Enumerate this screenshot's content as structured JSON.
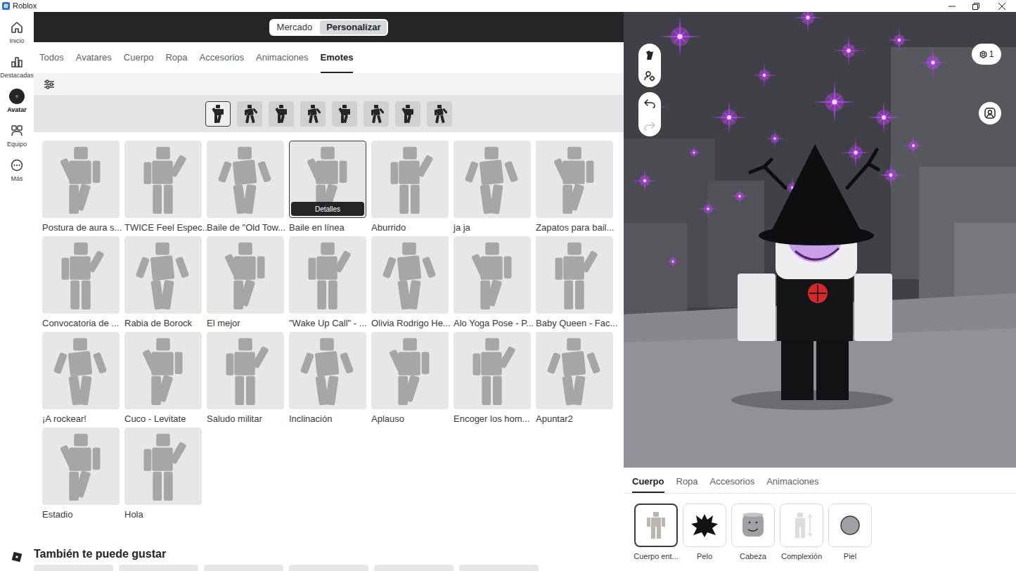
{
  "window": {
    "title": "Roblox"
  },
  "sidebar": {
    "items": [
      {
        "label": "Inicio",
        "selected": false
      },
      {
        "label": "Destacadas",
        "selected": false
      },
      {
        "label": "Avatar",
        "selected": true
      },
      {
        "label": "Equipo",
        "selected": false
      },
      {
        "label": "Más",
        "selected": false
      }
    ]
  },
  "mode_toggle": [
    {
      "label": "Mercado",
      "selected": false
    },
    {
      "label": "Personalizar",
      "selected": true
    }
  ],
  "category_tabs": [
    {
      "label": "Todos",
      "selected": false
    },
    {
      "label": "Avatares",
      "selected": false
    },
    {
      "label": "Cuerpo",
      "selected": false
    },
    {
      "label": "Ropa",
      "selected": false
    },
    {
      "label": "Accesorios",
      "selected": false
    },
    {
      "label": "Animaciones",
      "selected": false
    },
    {
      "label": "Emotes",
      "selected": true
    }
  ],
  "emote_slots": [
    {
      "selected": true
    },
    {
      "selected": false
    },
    {
      "selected": false
    },
    {
      "selected": false
    },
    {
      "selected": false
    },
    {
      "selected": false
    },
    {
      "selected": false
    },
    {
      "selected": false
    }
  ],
  "emotes": {
    "details_button": "Detalles",
    "items": [
      {
        "label": "Postura de aura s...",
        "hovered": false
      },
      {
        "label": "TWICE Feel Espec...",
        "hovered": false
      },
      {
        "label": "Baile de \"Old Tow...",
        "hovered": false
      },
      {
        "label": "Baile en línea",
        "hovered": true
      },
      {
        "label": "Aburrido",
        "hovered": false
      },
      {
        "label": "ja ja",
        "hovered": false
      },
      {
        "label": "Zapatos para bail...",
        "hovered": false
      },
      {
        "label": "Convocatoria de ...",
        "hovered": false
      },
      {
        "label": "Rabia de Borock",
        "hovered": false
      },
      {
        "label": "El mejor",
        "hovered": false
      },
      {
        "label": "\"Wake Up Call\" - ...",
        "hovered": false
      },
      {
        "label": "Olivia Rodrigo He...",
        "hovered": false
      },
      {
        "label": "Alo Yoga Pose - P...",
        "hovered": false
      },
      {
        "label": "Baby Queen - Fac...",
        "hovered": false
      },
      {
        "label": "¡A rockear!",
        "hovered": false
      },
      {
        "label": "Cuco - Levitate",
        "hovered": false
      },
      {
        "label": "Saludo militar",
        "hovered": false
      },
      {
        "label": "Inclinación",
        "hovered": false
      },
      {
        "label": "Aplauso",
        "hovered": false
      },
      {
        "label": "Encoger los hom...",
        "hovered": false
      },
      {
        "label": "Apuntar2",
        "hovered": false
      },
      {
        "label": "Estadio",
        "hovered": false
      },
      {
        "label": "Hola",
        "hovered": false
      }
    ]
  },
  "recommendations": {
    "title": "También te puede gustar"
  },
  "viewport": {
    "badge": "1",
    "redo_disabled": true
  },
  "editor": {
    "tabs": [
      {
        "label": "Cuerpo",
        "selected": true
      },
      {
        "label": "Ropa",
        "selected": false
      },
      {
        "label": "Accesorios",
        "selected": false
      },
      {
        "label": "Animaciones",
        "selected": false
      }
    ],
    "items": [
      {
        "label": "Cuerpo ent...",
        "selected": true
      },
      {
        "label": "Pelo",
        "selected": false
      },
      {
        "label": "Cabeza",
        "selected": false
      },
      {
        "label": "Complexión",
        "selected": false
      },
      {
        "label": "Piel",
        "selected": false
      }
    ]
  }
}
